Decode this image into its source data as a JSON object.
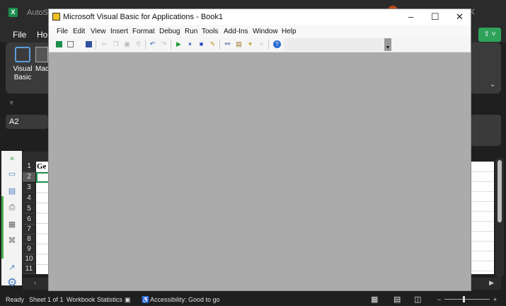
{
  "excel": {
    "autosave": "AutoSave",
    "menu": {
      "file": "File",
      "home": "Hon"
    },
    "ribbon": {
      "visual_basic": "Visual Basic",
      "macros": "Mac"
    },
    "name_box": "A2",
    "cell_a1": "Ge",
    "rows": [
      "1",
      "2",
      "3",
      "4",
      "5",
      "6",
      "7",
      "8",
      "9",
      "10",
      "11"
    ],
    "status": {
      "ready": "Ready",
      "sheet": "Sheet 1 of 1",
      "stats": "Workbook Statistics",
      "accessibility": "Accessibility: Good to go"
    }
  },
  "vba": {
    "title": "Microsoft Visual Basic for Applications - Book1",
    "menu": [
      "File",
      "Edit",
      "View",
      "Insert",
      "Format",
      "Debug",
      "Run",
      "Tools",
      "Add-Ins",
      "Window",
      "Help"
    ]
  },
  "colors": {
    "excel_green": "#1d8f4e",
    "vba_client": "#ababab"
  }
}
